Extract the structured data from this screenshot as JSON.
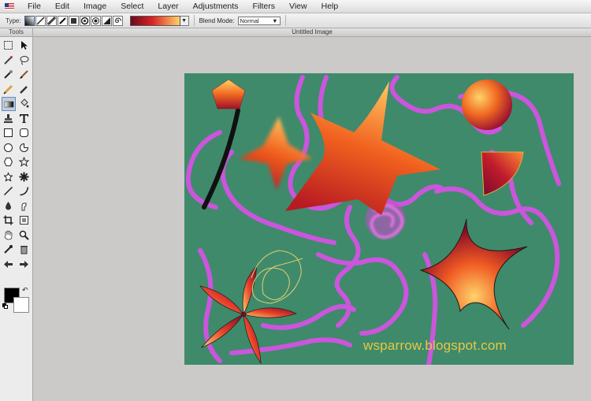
{
  "menubar": {
    "items": [
      "File",
      "Edit",
      "Image",
      "Select",
      "Layer",
      "Adjustments",
      "Filters",
      "View",
      "Help"
    ]
  },
  "options": {
    "type_label": "Type:",
    "blend_label": "Blend Mode:",
    "blend_value": "Normal",
    "dropdown_arrow": "▼"
  },
  "toolbox": {
    "title": "Tools",
    "tools": [
      "rect-select",
      "move",
      "lasso-select",
      "lasso",
      "magic-wand",
      "brush",
      "pencil",
      "eyedropper-brush",
      "gradient",
      "bucket",
      "stamp",
      "text",
      "rectangle",
      "rounded-rect",
      "ellipse",
      "pie",
      "polygon",
      "star",
      "star5",
      "gear-shape",
      "line",
      "curve",
      "drop",
      "smudge",
      "crop",
      "resize",
      "hand",
      "zoom",
      "color-picker",
      "trash",
      "back-arrow",
      "forward-arrow"
    ],
    "active_tool": "gradient",
    "swap_icon": "↶"
  },
  "document": {
    "title": "Untitled Image"
  },
  "canvas": {
    "background": "#3f8a6b",
    "watermark": "wsparrow.blogspot.com"
  },
  "colors": {
    "foreground": "#000000",
    "background": "#ffffff",
    "stroke_magenta": "#cc55dd",
    "gradient_dark": "#6b0a1f",
    "gradient_mid": "#e8402a",
    "gradient_light": "#ffd36a"
  }
}
